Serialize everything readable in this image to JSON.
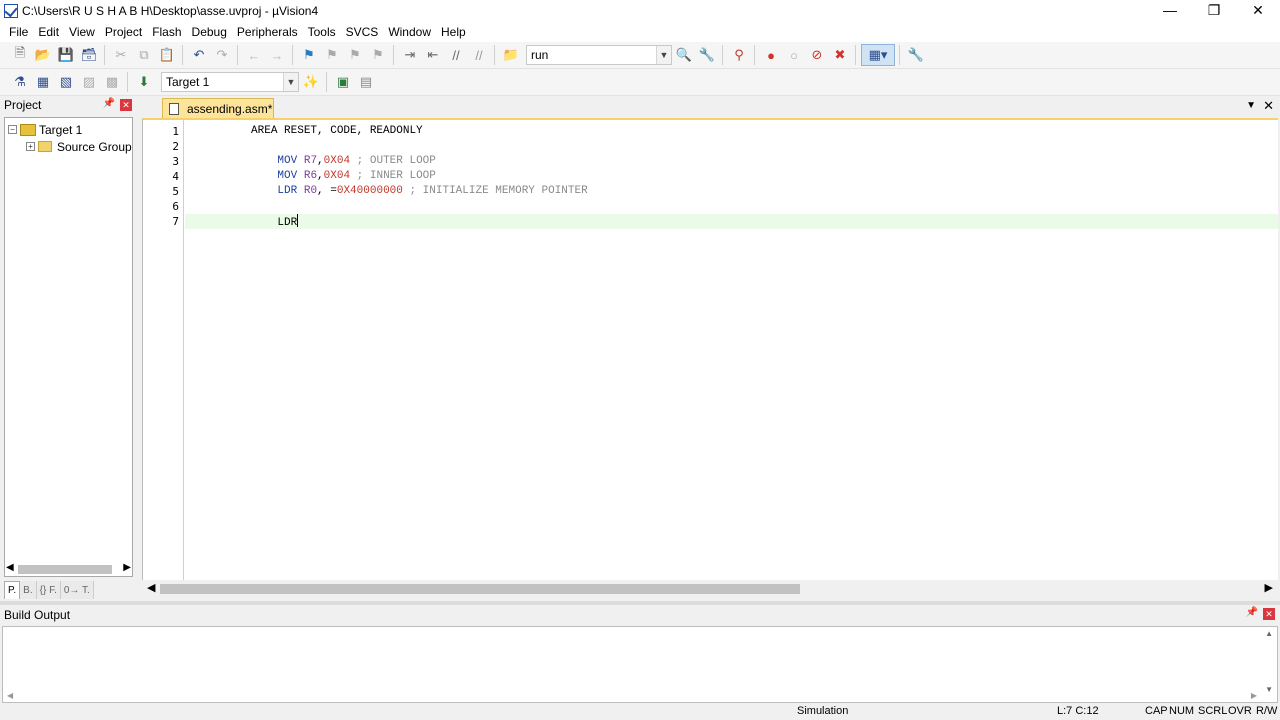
{
  "window": {
    "title": "C:\\Users\\R U S H A B H\\Desktop\\asse.uvproj - µVision4",
    "minimize": "—",
    "restore": "❐",
    "close": "✕"
  },
  "menu": [
    "File",
    "Edit",
    "View",
    "Project",
    "Flash",
    "Debug",
    "Peripherals",
    "Tools",
    "SVCS",
    "Window",
    "Help"
  ],
  "toolbar1": {
    "find_combo_value": "run"
  },
  "toolbar2": {
    "target_combo_value": "Target 1"
  },
  "project_panel": {
    "title": "Project",
    "tree": {
      "root": "Target 1",
      "child": "Source Group"
    },
    "tabs": [
      "P.",
      "B.",
      "{} F.",
      "0→ T."
    ]
  },
  "editor": {
    "tab_label": "assending.asm*",
    "lines": [
      {
        "n": "1",
        "indent": "    ",
        "parts": [
          {
            "t": "AREA RESET, CODE, READONLY",
            "c": ""
          }
        ]
      },
      {
        "n": "2",
        "indent": "",
        "parts": []
      },
      {
        "n": "3",
        "indent": "        ",
        "parts": [
          {
            "t": "MOV",
            "c": "kw"
          },
          {
            "t": " ",
            "c": ""
          },
          {
            "t": "R7",
            "c": "reg"
          },
          {
            "t": ",",
            "c": ""
          },
          {
            "t": "0X04",
            "c": "num"
          },
          {
            "t": " ; OUTER LOOP",
            "c": "cmt"
          }
        ]
      },
      {
        "n": "4",
        "indent": "        ",
        "parts": [
          {
            "t": "MOV",
            "c": "kw"
          },
          {
            "t": " ",
            "c": ""
          },
          {
            "t": "R6",
            "c": "reg"
          },
          {
            "t": ",",
            "c": ""
          },
          {
            "t": "0X04",
            "c": "num"
          },
          {
            "t": " ; INNER LOOP",
            "c": "cmt"
          }
        ]
      },
      {
        "n": "5",
        "indent": "        ",
        "parts": [
          {
            "t": "LDR",
            "c": "kw"
          },
          {
            "t": " ",
            "c": ""
          },
          {
            "t": "R0",
            "c": "reg"
          },
          {
            "t": ", =",
            "c": ""
          },
          {
            "t": "0X40000000",
            "c": "num"
          },
          {
            "t": " ; INITIALIZE MEMORY POINTER",
            "c": "cmt"
          }
        ]
      },
      {
        "n": "6",
        "indent": "",
        "parts": []
      },
      {
        "n": "7",
        "indent": "        ",
        "parts": [
          {
            "t": "LDR",
            "c": ""
          }
        ],
        "current": true
      }
    ]
  },
  "build_output": {
    "title": "Build Output"
  },
  "status": {
    "mode": "Simulation",
    "position": "L:7 C:12",
    "cap": "CAP",
    "num": "NUM",
    "scrl": "SCRL",
    "ovr": "OVR",
    "rw": "R/W"
  },
  "colors": {
    "keyword": "#1e3fa3",
    "register": "#7a3c9a",
    "number": "#c0392b",
    "comment": "#8a8a8a",
    "current_line": "#eafbe8",
    "tab_active": "#fce49a"
  }
}
